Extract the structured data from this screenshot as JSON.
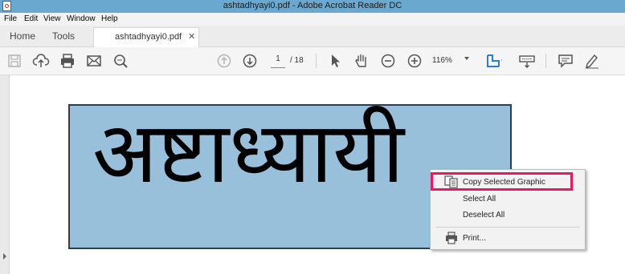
{
  "window": {
    "title": "ashtadhyayi0.pdf - Adobe Acrobat Reader DC"
  },
  "menubar": {
    "items": [
      "File",
      "Edit",
      "View",
      "Window",
      "Help"
    ]
  },
  "tabs": {
    "home": "Home",
    "tools": "Tools",
    "document": "ashtadhyayi0.pdf",
    "close": "✕"
  },
  "toolbar": {
    "current_page": "1",
    "total_pages": "/ 18",
    "zoom": "116%",
    "icons": [
      "save-icon",
      "upload-icon",
      "print-icon",
      "mail-icon",
      "search-icon",
      "page-up-icon",
      "page-down-icon",
      "select-arrow-icon",
      "hand-icon",
      "zoom-out-icon",
      "zoom-in-icon",
      "fit-page-icon",
      "keyboard-icon",
      "comment-icon",
      "sign-icon"
    ]
  },
  "document": {
    "graphic_text": "अष्टाध्यायी",
    "graphic_bg": "#98c0da"
  },
  "context_menu": {
    "copy_graphic": "Copy Selected Graphic",
    "select_all": "Select All",
    "deselect_all": "Deselect All",
    "print": "Print...",
    "highlight_color": "#e8195c"
  }
}
